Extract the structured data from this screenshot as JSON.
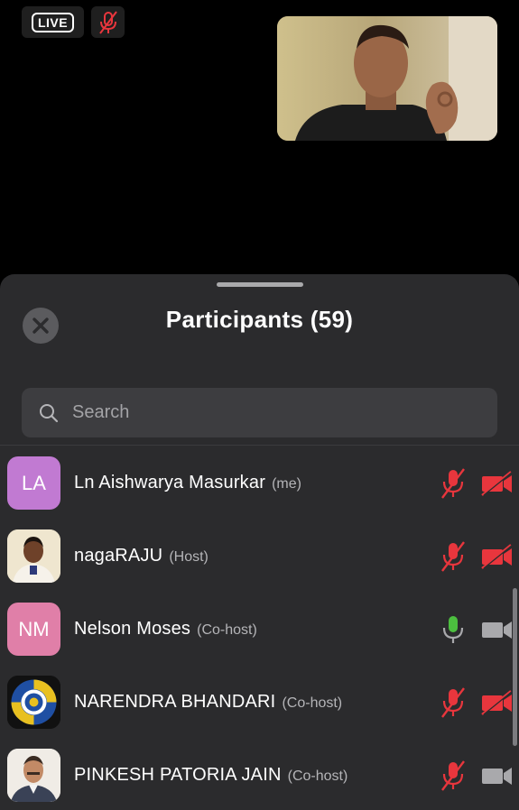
{
  "header": {
    "live_label": "LIVE",
    "mic_icon": "mic-muted-icon"
  },
  "self_video": {
    "description_icon": "video-feed"
  },
  "panel": {
    "title": "Participants (59)",
    "close_icon": "close-icon",
    "search_placeholder": "Search"
  },
  "participants": [
    {
      "initials": "LA",
      "name": "Ln Aishwarya Masurkar",
      "role": "(me)",
      "avatar_color": "#c17ad2",
      "mic": "muted",
      "video": "off"
    },
    {
      "initials": "",
      "name": "nagaRAJU",
      "role": "(Host)",
      "avatar_color": "#e8d9b4",
      "mic": "muted",
      "video": "off"
    },
    {
      "initials": "NM",
      "name": "Nelson Moses",
      "role": "(Co-host)",
      "avatar_color": "#e07fa8",
      "mic": "on",
      "video": "on"
    },
    {
      "initials": "",
      "name": "NARENDRA BHANDARI",
      "role": "(Co-host)",
      "avatar_color": "#111111",
      "mic": "muted",
      "video": "off"
    },
    {
      "initials": "",
      "name": "PINKESH PATORIA JAIN",
      "role": "(Co-host)",
      "avatar_color": "#f0ece6",
      "mic": "muted",
      "video": "on"
    }
  ],
  "colors": {
    "muted_red": "#e8363d",
    "active_green": "#4cbf3f",
    "icon_gray": "#a9a9ac"
  }
}
